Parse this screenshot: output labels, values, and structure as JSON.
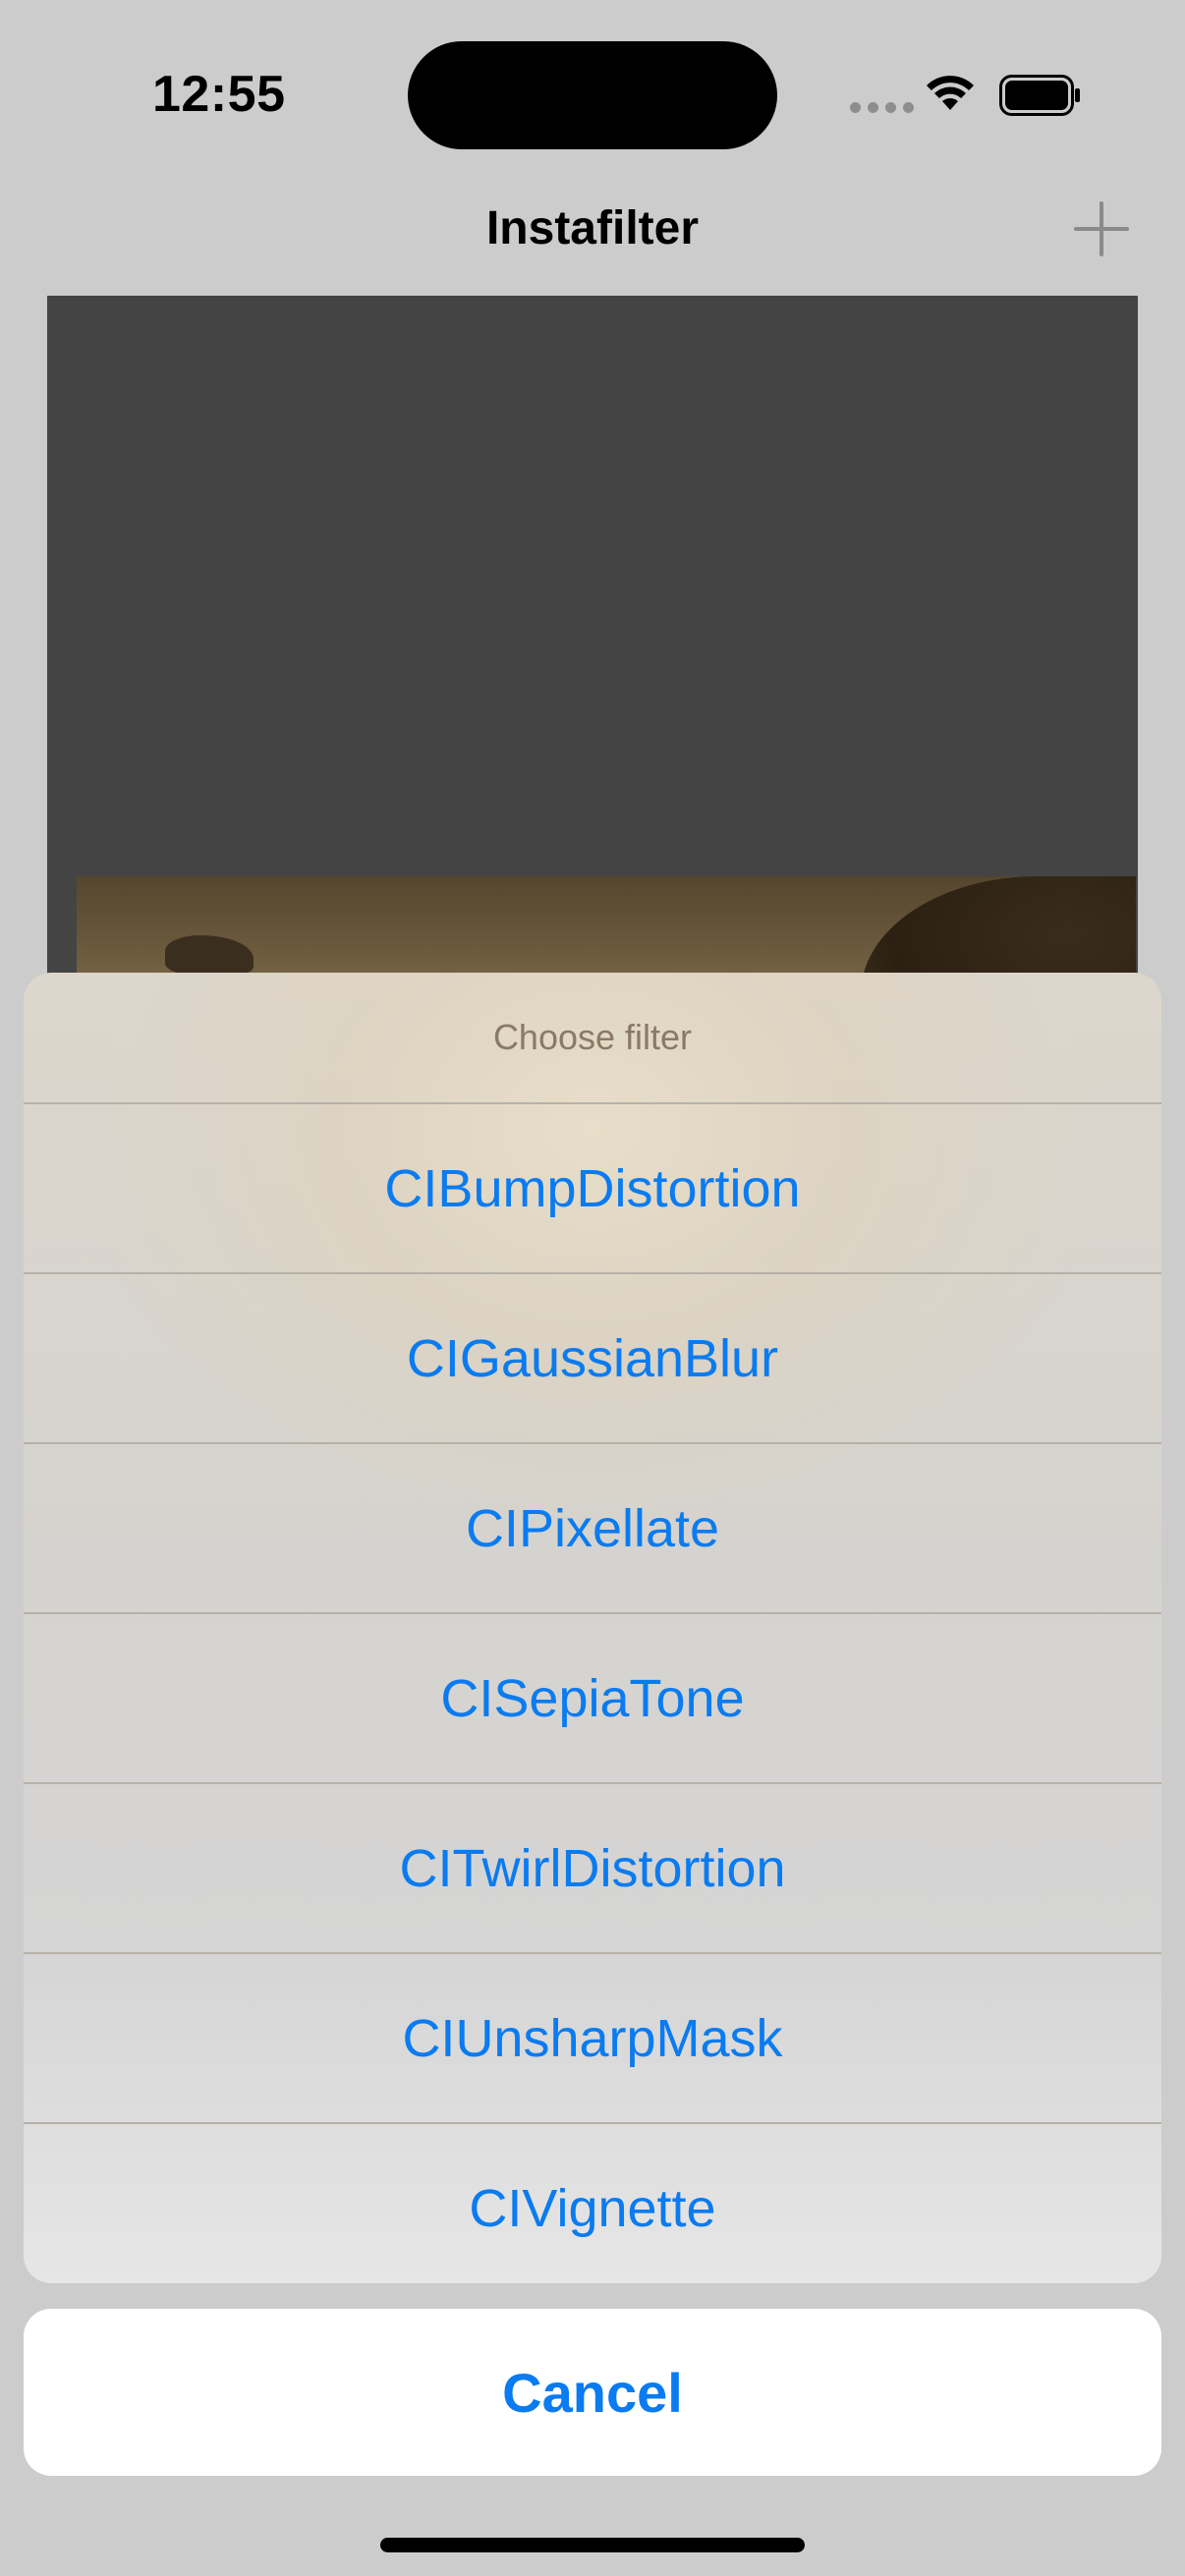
{
  "status_bar": {
    "time": "12:55",
    "icons": [
      "cellular-dots-icon",
      "wifi-icon",
      "battery-icon"
    ]
  },
  "nav": {
    "title": "Instafilter",
    "add_icon": "plus-icon"
  },
  "action_sheet": {
    "title": "Choose filter",
    "options": [
      {
        "label": "CIBumpDistortion"
      },
      {
        "label": "CIGaussianBlur"
      },
      {
        "label": "CIPixellate"
      },
      {
        "label": "CISepiaTone"
      },
      {
        "label": "CITwirlDistortion"
      },
      {
        "label": "CIUnsharpMask"
      },
      {
        "label": "CIVignette"
      }
    ],
    "cancel_label": "Cancel"
  },
  "colors": {
    "accent": "#0a7bf0",
    "image_background": "#444444",
    "screen_background": "#cccccc"
  }
}
